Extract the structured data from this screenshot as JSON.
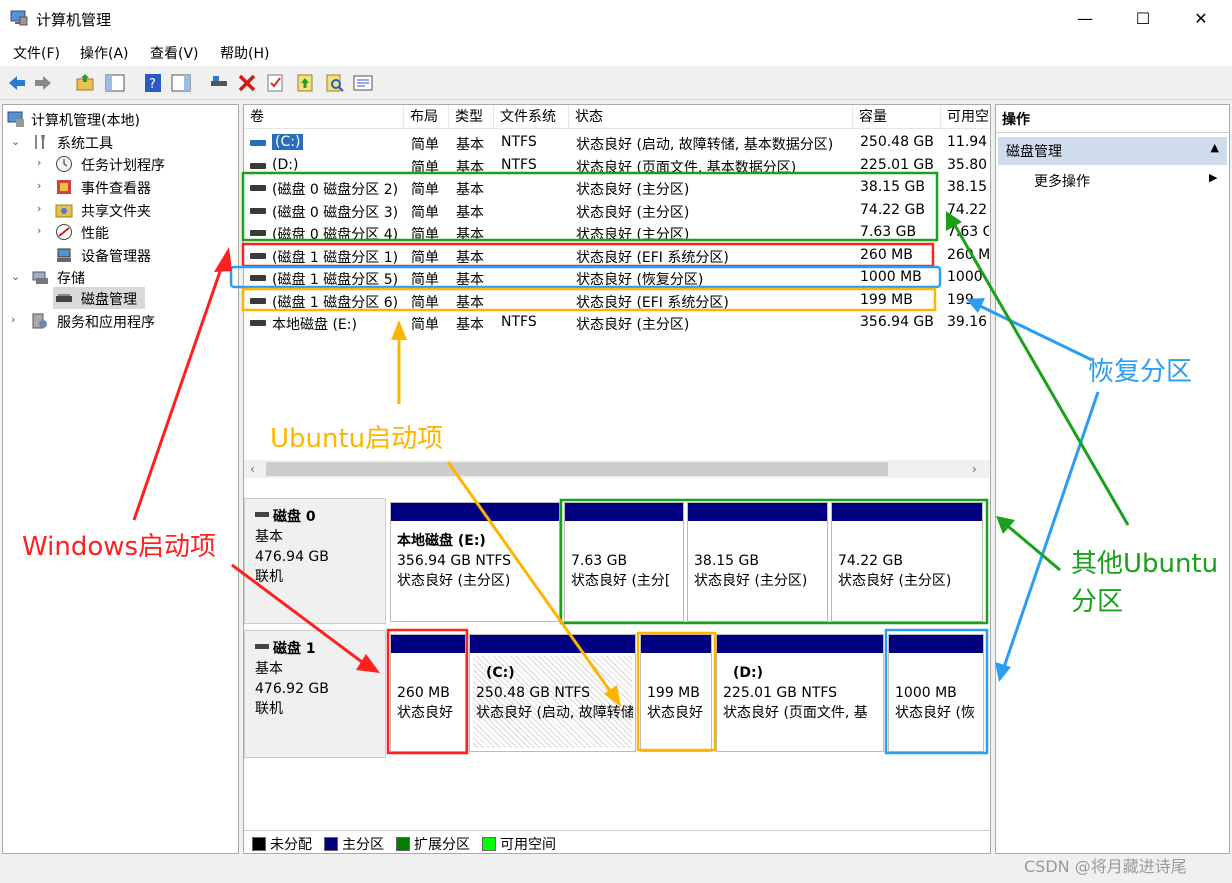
{
  "window": {
    "title": "计算机管理",
    "min": "—",
    "max": "☐",
    "close": "✕"
  },
  "menu": {
    "file": "文件(F)",
    "action": "操作(A)",
    "view": "查看(V)",
    "help": "帮助(H)"
  },
  "tree": {
    "root": "计算机管理(本地)",
    "system_tools": "系统工具",
    "task_scheduler": "任务计划程序",
    "event_viewer": "事件查看器",
    "shared_folders": "共享文件夹",
    "performance": "性能",
    "device_manager": "设备管理器",
    "storage": "存储",
    "disk_management": "磁盘管理",
    "services": "服务和应用程序"
  },
  "list": {
    "headers": [
      "卷",
      "布局",
      "类型",
      "文件系统",
      "状态",
      "容量",
      "可用空"
    ],
    "rows": [
      {
        "vol": "(C:)",
        "layout": "简单",
        "type": "基本",
        "fs": "NTFS",
        "status": "状态良好 (启动, 故障转储, 基本数据分区)",
        "cap": "250.48 GB",
        "free": "11.94"
      },
      {
        "vol": "(D:)",
        "layout": "简单",
        "type": "基本",
        "fs": "NTFS",
        "status": "状态良好 (页面文件, 基本数据分区)",
        "cap": "225.01 GB",
        "free": "35.80"
      },
      {
        "vol": "(磁盘 0 磁盘分区 2)",
        "layout": "简单",
        "type": "基本",
        "fs": "",
        "status": "状态良好 (主分区)",
        "cap": "38.15 GB",
        "free": "38.15"
      },
      {
        "vol": "(磁盘 0 磁盘分区 3)",
        "layout": "简单",
        "type": "基本",
        "fs": "",
        "status": "状态良好 (主分区)",
        "cap": "74.22 GB",
        "free": "74.22"
      },
      {
        "vol": "(磁盘 0 磁盘分区 4)",
        "layout": "简单",
        "type": "基本",
        "fs": "",
        "status": "状态良好 (主分区)",
        "cap": "7.63 GB",
        "free": "7.63 G"
      },
      {
        "vol": "(磁盘 1 磁盘分区 1)",
        "layout": "简单",
        "type": "基本",
        "fs": "",
        "status": "状态良好 (EFI 系统分区)",
        "cap": "260 MB",
        "free": "260 M"
      },
      {
        "vol": "(磁盘 1 磁盘分区 5)",
        "layout": "简单",
        "type": "基本",
        "fs": "",
        "status": "状态良好 (恢复分区)",
        "cap": "1000 MB",
        "free": "1000"
      },
      {
        "vol": "(磁盘 1 磁盘分区 6)",
        "layout": "简单",
        "type": "基本",
        "fs": "",
        "status": "状态良好 (EFI 系统分区)",
        "cap": "199 MB",
        "free": "199"
      },
      {
        "vol": "本地磁盘 (E:)",
        "layout": "简单",
        "type": "基本",
        "fs": "NTFS",
        "status": "状态良好 (主分区)",
        "cap": "356.94 GB",
        "free": "39.16"
      }
    ]
  },
  "disk0": {
    "name": "磁盘 0",
    "kind": "基本",
    "size": "476.94 GB",
    "state": "联机",
    "parts": [
      {
        "title": "本地磁盘  (E:)",
        "line1": "356.94 GB NTFS",
        "line2": "状态良好 (主分区)"
      },
      {
        "title": "",
        "line1": "7.63 GB",
        "line2": "状态良好 (主分["
      },
      {
        "title": "",
        "line1": "38.15 GB",
        "line2": "状态良好 (主分区)"
      },
      {
        "title": "",
        "line1": "74.22 GB",
        "line2": "状态良好 (主分区)"
      }
    ]
  },
  "disk1": {
    "name": "磁盘 1",
    "kind": "基本",
    "size": "476.92 GB",
    "state": "联机",
    "parts": [
      {
        "title": "",
        "line1": "260 MB",
        "line2": "状态良好"
      },
      {
        "title": "(C:)",
        "line1": "250.48 GB NTFS",
        "line2": "状态良好 (启动, 故障转储"
      },
      {
        "title": "",
        "line1": "199 MB",
        "line2": "状态良好"
      },
      {
        "title": "(D:)",
        "line1": "225.01 GB NTFS",
        "line2": "状态良好 (页面文件, 基"
      },
      {
        "title": "",
        "line1": "1000 MB",
        "line2": "状态良好 (恢"
      }
    ]
  },
  "legend": {
    "unallocated": "未分配",
    "primary": "主分区",
    "extended": "扩展分区",
    "free": "可用空间",
    "colors": {
      "unallocated": "#000000",
      "primary": "#000080",
      "extended": "#008000",
      "free": "#00ff00"
    }
  },
  "actions": {
    "title": "操作",
    "section": "磁盘管理",
    "more": "更多操作"
  },
  "annotations": {
    "windows_boot": "Windows启动项",
    "ubuntu_boot": "Ubuntu启动项",
    "recovery": "恢复分区",
    "other_ubuntu_1": "其他Ubuntu",
    "other_ubuntu_2": "分区",
    "colors": {
      "red": "#ff2020",
      "yellow": "#ffb400",
      "blue": "#2a9df4",
      "green": "#1aa01a"
    }
  },
  "watermark": "CSDN @将月藏进诗尾"
}
